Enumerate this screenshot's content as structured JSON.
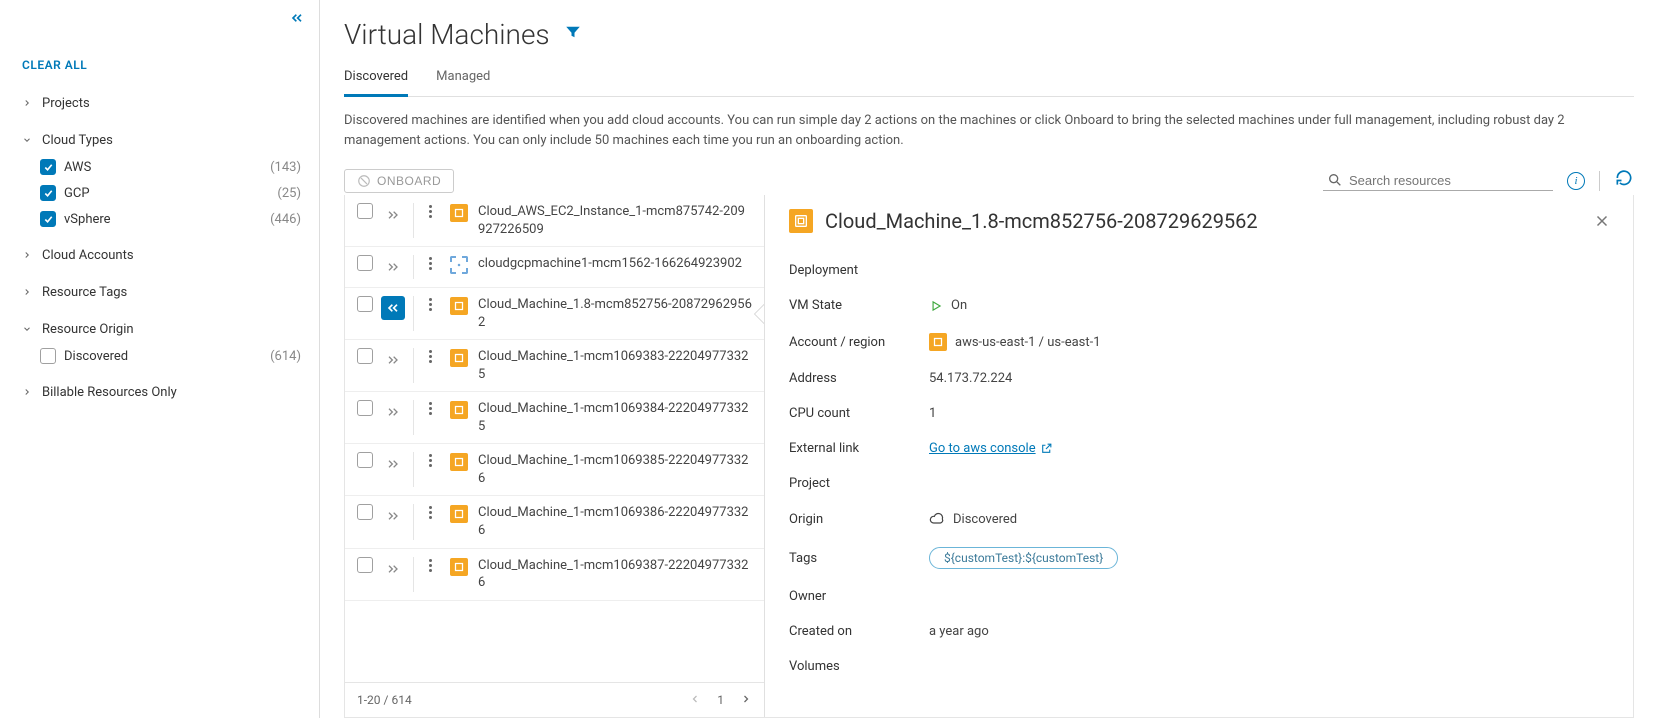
{
  "sidebar": {
    "clear_all": "CLEAR ALL",
    "facets": [
      {
        "label": "Projects",
        "expanded": false,
        "items": []
      },
      {
        "label": "Cloud Types",
        "expanded": true,
        "items": [
          {
            "label": "AWS",
            "count": "(143)",
            "checked": true
          },
          {
            "label": "GCP",
            "count": "(25)",
            "checked": true
          },
          {
            "label": "vSphere",
            "count": "(446)",
            "checked": true
          }
        ]
      },
      {
        "label": "Cloud Accounts",
        "expanded": false,
        "items": []
      },
      {
        "label": "Resource Tags",
        "expanded": false,
        "items": []
      },
      {
        "label": "Resource Origin",
        "expanded": true,
        "items": [
          {
            "label": "Discovered",
            "count": "(614)",
            "checked": false
          }
        ]
      },
      {
        "label": "Billable Resources Only",
        "expanded": false,
        "items": []
      }
    ]
  },
  "header": {
    "title": "Virtual Machines",
    "tabs": [
      "Discovered",
      "Managed"
    ],
    "active_tab": 0,
    "description": "Discovered machines are identified when you add cloud accounts. You can run simple day 2 actions on the machines or click Onboard to bring the selected machines under full management, including robust day 2 management actions. You can only include 50 machines each time you run an onboarding action."
  },
  "toolbar": {
    "onboard_label": "ONBOARD",
    "search_placeholder": "Search resources"
  },
  "table": {
    "rows": [
      {
        "name": "Cloud_AWS_EC2_Instance_1-mcm875742-209927226509",
        "icon": "orange",
        "selected": false,
        "expanded": false
      },
      {
        "name": "cloudgcpmachine1-mcm1562-166264923902",
        "icon": "gcp",
        "selected": false,
        "expanded": false
      },
      {
        "name": "Cloud_Machine_1.8-mcm852756-208729629562",
        "icon": "orange",
        "selected": true,
        "expanded": true
      },
      {
        "name": "Cloud_Machine_1-mcm1069383-222049773325",
        "icon": "orange",
        "selected": false,
        "expanded": false
      },
      {
        "name": "Cloud_Machine_1-mcm1069384-222049773325",
        "icon": "orange",
        "selected": false,
        "expanded": false
      },
      {
        "name": "Cloud_Machine_1-mcm1069385-222049773326",
        "icon": "orange",
        "selected": false,
        "expanded": false
      },
      {
        "name": "Cloud_Machine_1-mcm1069386-222049773326",
        "icon": "orange",
        "selected": false,
        "expanded": false
      },
      {
        "name": "Cloud_Machine_1-mcm1069387-222049773326",
        "icon": "orange",
        "selected": false,
        "expanded": false
      }
    ],
    "pager": {
      "range": "1-20 / 614",
      "page": "1"
    }
  },
  "detail": {
    "title": "Cloud_Machine_1.8-mcm852756-208729629562",
    "props": {
      "deployment_k": "Deployment",
      "deployment_v": "",
      "vmstate_k": "VM State",
      "vmstate_v": "On",
      "account_k": "Account / region",
      "account_v": "aws-us-east-1 / us-east-1",
      "address_k": "Address",
      "address_v": "54.173.72.224",
      "cpu_k": "CPU count",
      "cpu_v": "1",
      "extlink_k": "External link",
      "extlink_v": "Go to aws console",
      "project_k": "Project",
      "project_v": "",
      "origin_k": "Origin",
      "origin_v": "Discovered",
      "tags_k": "Tags",
      "tags_v": "${customTest}:${customTest}",
      "owner_k": "Owner",
      "owner_v": "",
      "created_k": "Created on",
      "created_v": "a year ago",
      "volumes_k": "Volumes",
      "volumes_v": ""
    }
  }
}
